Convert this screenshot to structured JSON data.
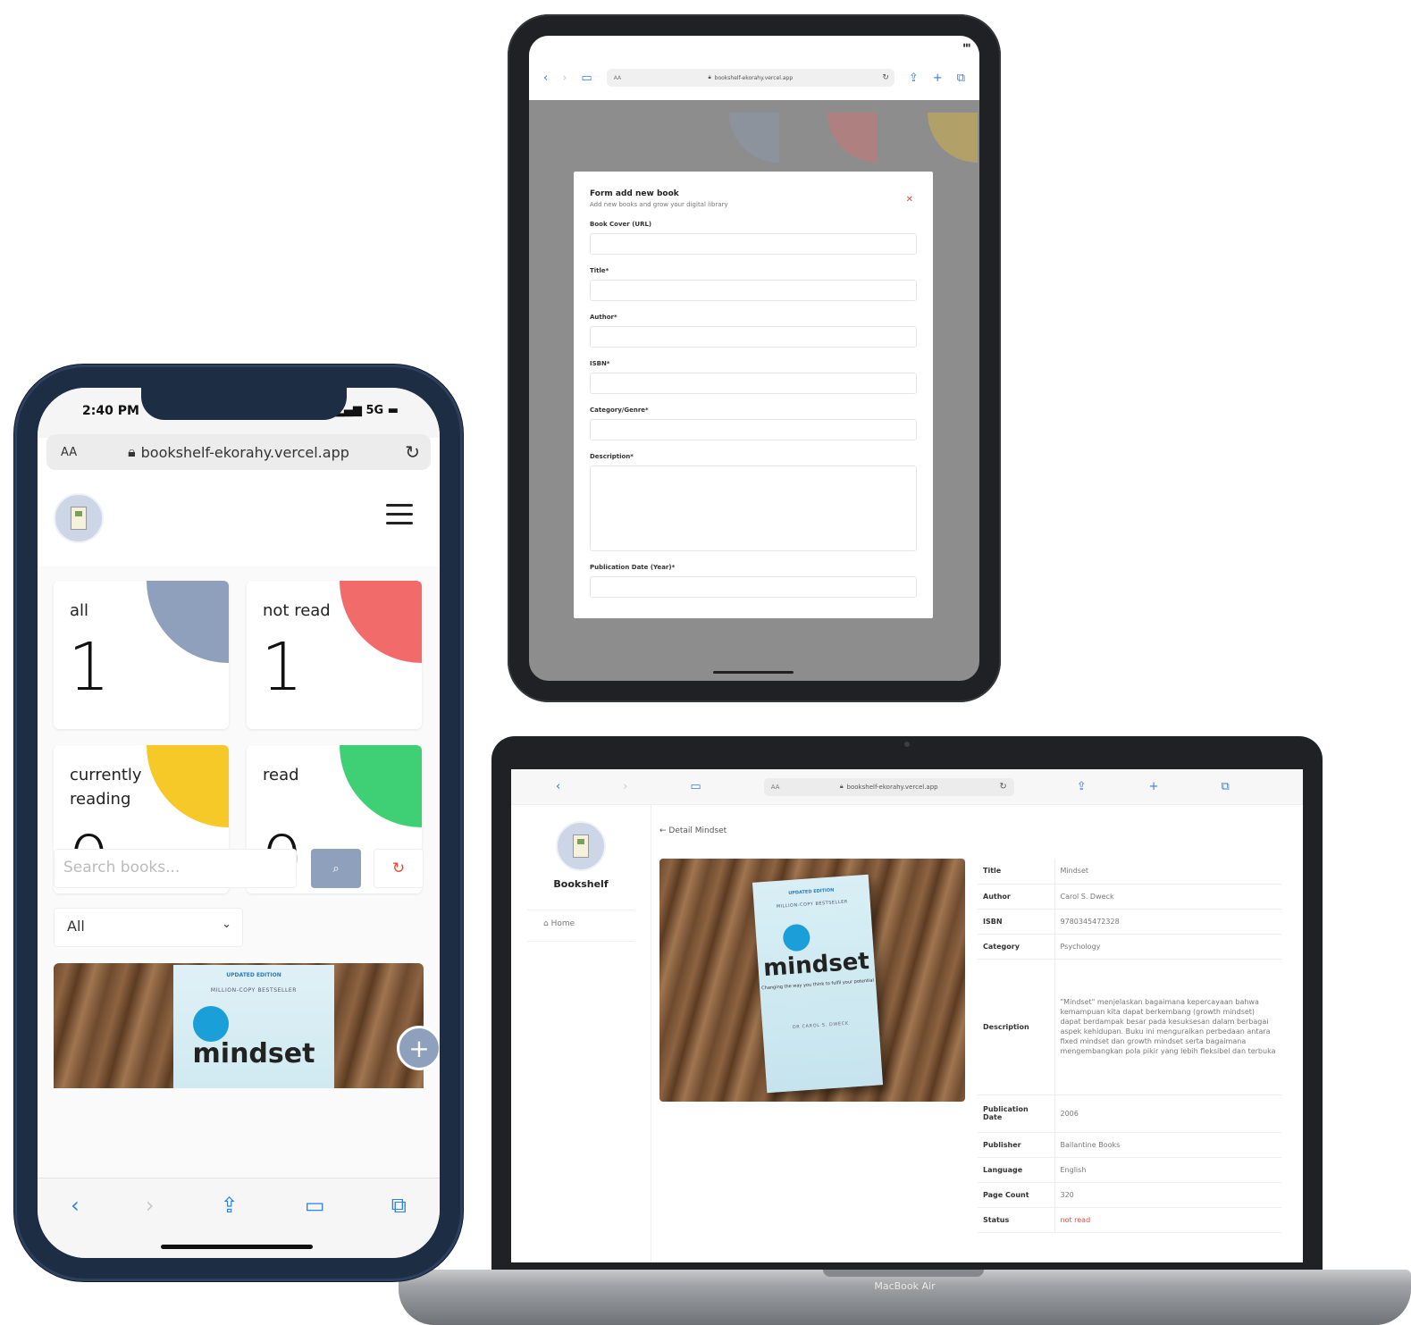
{
  "tablet": {
    "status_time": "",
    "url": "bookshelf-ekorahy.vercel.app",
    "aa": "AA",
    "modal": {
      "title": "Form add new book",
      "subtitle": "Add new books and grow your digital library",
      "fields": [
        {
          "label": "Book Cover (URL)",
          "value": "",
          "type": "text"
        },
        {
          "label": "Title*",
          "value": "",
          "type": "text"
        },
        {
          "label": "Author*",
          "value": "",
          "type": "text"
        },
        {
          "label": "ISBN*",
          "value": "",
          "type": "text"
        },
        {
          "label": "Category/Genre*",
          "value": "",
          "type": "text"
        },
        {
          "label": "Description*",
          "value": "",
          "type": "textarea"
        },
        {
          "label": "Publication Date (Year)*",
          "value": "",
          "type": "text"
        }
      ]
    },
    "bg_colors": [
      "#8fa0bd",
      "#f26b6b",
      "#f6c928"
    ]
  },
  "laptop": {
    "url": "bookshelf-ekorahy.vercel.app",
    "aa": "AA",
    "brand": "Bookshelf",
    "nav_home": "Home",
    "breadcrumb": "← Detail Mindset",
    "base_label": "MacBook Air",
    "book_cover": {
      "edition": "UPDATED EDITION",
      "banner": "MILLION-COPY BESTSELLER",
      "title": "mindset",
      "tagline": "Changing the way you think to fulfil your potential",
      "author": "DR CAROL S. DWECK"
    },
    "details": [
      {
        "key": "Title",
        "value": "Mindset"
      },
      {
        "key": "Author",
        "value": "Carol S. Dweck"
      },
      {
        "key": "ISBN",
        "value": "9780345472328"
      },
      {
        "key": "Category",
        "value": "Psychology"
      },
      {
        "key": "Description",
        "value": "\"Mindset\" menjelaskan bagaimana kepercayaan bahwa kemampuan kita dapat berkembang (growth mindset) dapat berdampak besar pada kesuksesan dalam berbagai aspek kehidupan. Buku ini menguraikan perbedaan antara fixed mindset dan growth mindset serta bagaimana mengembangkan pola pikir yang lebih fleksibel dan terbuka"
      },
      {
        "key": "Publication Date",
        "value": "2006"
      },
      {
        "key": "Publisher",
        "value": "Ballantine Books"
      },
      {
        "key": "Language",
        "value": "English"
      },
      {
        "key": "Page Count",
        "value": "320"
      },
      {
        "key": "Status",
        "value": "not read"
      }
    ],
    "status_color": "#e74c3c"
  },
  "phone": {
    "time": "2:40 PM",
    "network": "5G",
    "aa": "AA",
    "url": "bookshelf-ekorahy.vercel.app",
    "stats": [
      {
        "label": "all",
        "count": "1",
        "color": "#8fa0bd"
      },
      {
        "label": "not read",
        "count": "1",
        "color": "#f26b6b"
      },
      {
        "label": "currently reading",
        "count": "0",
        "color": "#f6c928"
      },
      {
        "label": "read",
        "count": "0",
        "color": "#3fcf74"
      }
    ],
    "search_placeholder": "Search books...",
    "filter_selected": "All",
    "book_cover": {
      "edition": "UPDATED EDITION",
      "banner": "MILLION-COPY BESTSELLER",
      "title": "mindset"
    },
    "add_button": "+"
  },
  "icons": {
    "back": "chevron-left-icon",
    "forward": "chevron-right-icon",
    "share": "share-icon",
    "bookmarks": "book-open-icon",
    "tabs": "tabs-icon",
    "reload": "reload-icon",
    "lock": "lock-icon",
    "search": "search-icon",
    "reset": "refresh-icon",
    "close": "close-icon",
    "menu": "hamburger-icon",
    "add": "plus-icon"
  }
}
